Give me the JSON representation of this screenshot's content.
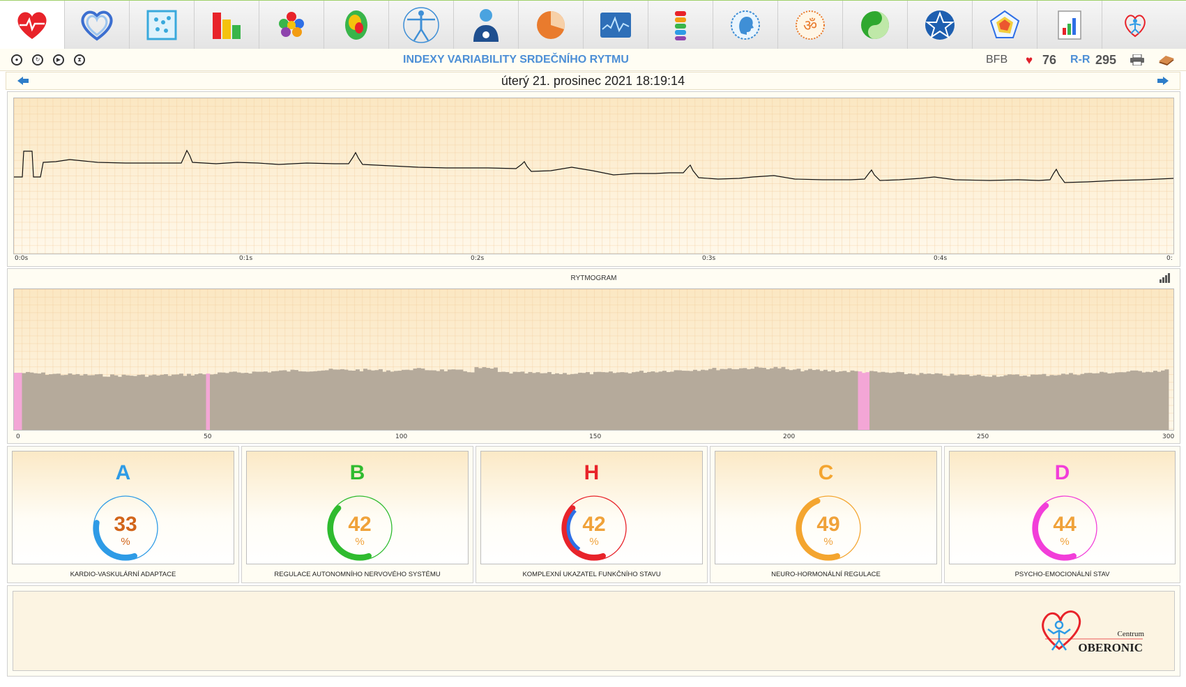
{
  "toolbar": {
    "tools": [
      {
        "icon": "heart-ecg-icon"
      },
      {
        "icon": "double-heart-icon"
      },
      {
        "icon": "dots-grid-icon"
      },
      {
        "icon": "bar-chart-icon"
      },
      {
        "icon": "hexagons-icon"
      },
      {
        "icon": "brain-map-icon"
      },
      {
        "icon": "vitruvian-man-icon"
      },
      {
        "icon": "doctor-icon"
      },
      {
        "icon": "pie-chart-icon"
      },
      {
        "icon": "waveform-icon"
      },
      {
        "icon": "spine-icon"
      },
      {
        "icon": "head-profile-icon"
      },
      {
        "icon": "om-symbol-icon"
      },
      {
        "icon": "yin-yang-icon"
      },
      {
        "icon": "pentagram-icon"
      },
      {
        "icon": "radar-pentagon-icon"
      },
      {
        "icon": "report-chart-icon"
      },
      {
        "icon": "oberonic-logo-icon"
      }
    ]
  },
  "status": {
    "title": "INDEXY VARIABILITY SRDEČNÍHO RYTMU",
    "bfb": "BFB",
    "heart_rate": "76",
    "rr_label": "R-R",
    "rr_value": "295"
  },
  "datebar": {
    "date": "úterý 21. prosinec 2021 18:19:14"
  },
  "ecg": {
    "x_ticks": [
      "0:0s",
      "0:1s",
      "0:2s",
      "0:3s",
      "0:4s",
      "0:"
    ],
    "trace_color": "#111111"
  },
  "rytmogram": {
    "title": "RYTMOGRAM",
    "x_ticks": [
      "0",
      "50",
      "100",
      "150",
      "200",
      "250",
      "300"
    ],
    "bar_color": "#b5aa9b",
    "highlight_color": "#f3a6d6"
  },
  "chart_data": [
    {
      "type": "line",
      "x": [
        0.0,
        0.01,
        0.02,
        0.03,
        0.05,
        0.08,
        0.1,
        0.15,
        0.2,
        0.25,
        0.3,
        0.35,
        0.4,
        0.45,
        0.5
      ],
      "xlabel": "",
      "ylabel": ""
    },
    {
      "type": "bar",
      "title": "RYTMOGRAM",
      "xlim": [
        0,
        300
      ],
      "highlighted_beats": [
        0,
        49,
        219,
        220,
        221
      ]
    }
  ],
  "indexes": [
    {
      "letter": "A",
      "value": "33",
      "percent": "%",
      "caption": "KARDIO-VASKULÁRNÍ ADAPTACE",
      "color": "#2e9be6",
      "value_color": "#d2651a",
      "fraction": 0.33
    },
    {
      "letter": "B",
      "value": "42",
      "percent": "%",
      "caption": "REGULACE AUTONOMNÍHO NERVOVÉHO SYSTÉMU",
      "color": "#2fbb2f",
      "value_color": "#f0a23a",
      "fraction": 0.42
    },
    {
      "letter": "H",
      "value": "42",
      "percent": "%",
      "caption": "KOMPLEXNÍ UKAZATEL FUNKČNÍHO STAVU",
      "color": "#e8232a",
      "value_color": "#f0a23a",
      "fraction": 0.42,
      "inner_color": "#2e6fe6"
    },
    {
      "letter": "C",
      "value": "49",
      "percent": "%",
      "caption": "NEURO-HORMONÁLNÍ REGULACE",
      "color": "#f4a52f",
      "value_color": "#f0a23a",
      "fraction": 0.49
    },
    {
      "letter": "D",
      "value": "44",
      "percent": "%",
      "caption": "PSYCHO-EMOCIONÁLNÍ STAV",
      "color": "#f23ed9",
      "value_color": "#f0a23a",
      "fraction": 0.44
    }
  ],
  "logo": {
    "centrum": "Centrum",
    "name": "OBERONIC"
  }
}
